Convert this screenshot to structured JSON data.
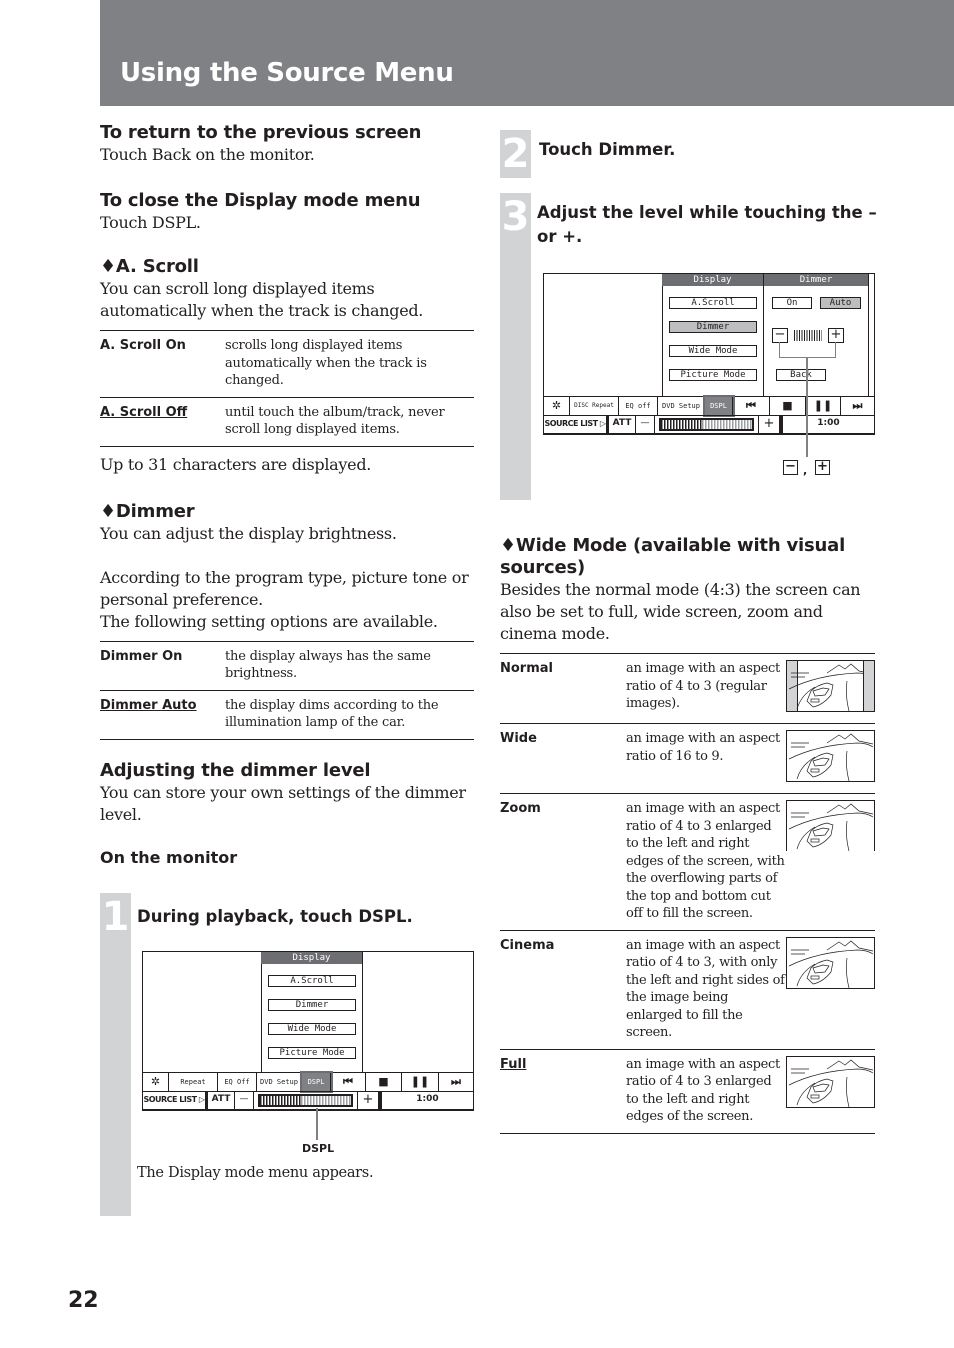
{
  "header": {
    "title": "Using the Source Menu"
  },
  "page_number": "22",
  "left": {
    "return_heading": "To return to the previous screen",
    "return_text": "Touch Back on the monitor.",
    "close_heading": "To close the Display mode menu",
    "close_text": "Touch DSPL.",
    "ascroll": {
      "heading": "♦A. Scroll",
      "intro": "You can scroll long displayed items automatically when the track is changed.",
      "options": [
        {
          "key": "A. Scroll On",
          "value": "scrolls long displayed items automatically when the track is changed.",
          "default": false
        },
        {
          "key": "A. Scroll Off",
          "value": "until touch the album/track, never scroll long displayed items.",
          "default": true
        }
      ],
      "note": "Up to 31 characters are displayed."
    },
    "dimmer": {
      "heading": "♦Dimmer",
      "intro1": "You can adjust the display brightness.",
      "intro2": "According to the program type, picture tone or personal preference.",
      "intro3": "The following setting options are available.",
      "options": [
        {
          "key": "Dimmer On",
          "value": "the display always has the same brightness.",
          "default": false
        },
        {
          "key": "Dimmer Auto",
          "value": "the display dims according to the illumination lamp of the car.",
          "default": true
        }
      ]
    },
    "adjusting": {
      "heading": "Adjusting the dimmer level",
      "text": "You can store your own settings of the dimmer level.",
      "subheading": "On the monitor"
    },
    "step1": {
      "number": "1",
      "title": "During playback, touch DSPL.",
      "callout": "DSPL",
      "caption": "The Display mode menu appears."
    }
  },
  "monitor1": {
    "panel_title": "Display",
    "menu": [
      "A.Scroll",
      "Dimmer",
      "Wide Mode",
      "Picture Mode"
    ],
    "controls": [
      "Repeat",
      "EQ Off",
      "DVD Setup",
      "DSPL"
    ],
    "source_list": "SOURCE LIST ▷",
    "att": "ATT",
    "minus": "—",
    "plus": "+",
    "time": "1:00",
    "volume_level": 0.45
  },
  "right": {
    "step2": {
      "number": "2",
      "title": "Touch Dimmer."
    },
    "step3": {
      "number": "3",
      "title": "Adjust the level while touching the – or +."
    },
    "wide": {
      "heading": "♦Wide Mode (available with visual sources)",
      "intro": "Besides the normal mode (4:3) the screen can also be set to full, wide screen, zoom and cinema mode.",
      "options": [
        {
          "key": "Normal",
          "value": "an image with an aspect ratio of 4 to 3 (regular images).",
          "default": false,
          "thumb": "normal"
        },
        {
          "key": "Wide",
          "value": "an image with an aspect ratio of 16 to 9.",
          "default": false,
          "thumb": "wide"
        },
        {
          "key": "Zoom",
          "value": "an image with an aspect ratio of 4 to 3 enlarged to the left and right edges of the screen, with the overflowing parts of the top and bottom cut off to fill the screen.",
          "default": false,
          "thumb": "zoom"
        },
        {
          "key": "Cinema",
          "value": "an image with an aspect ratio of 4 to 3, with only the left and right sides of the image being enlarged to fill the screen.",
          "default": false,
          "thumb": "cinema"
        },
        {
          "key": "Full",
          "value": "an image with an aspect ratio of 4 to 3 enlarged to the left and right edges of the screen.",
          "default": true,
          "thumb": "full"
        }
      ]
    }
  },
  "monitor2": {
    "panel_title": "Display",
    "menu": [
      "A.Scroll",
      "Dimmer",
      "Wide Mode",
      "Picture Mode"
    ],
    "selected": "Dimmer",
    "sub_title": "Dimmer",
    "sub_on": "On",
    "sub_auto": "Auto",
    "sub_back": "Back",
    "controls": [
      "DISC Repeat",
      "EQ off",
      "DVD Setup",
      "DSPL"
    ],
    "source_list": "SOURCE LIST ▷",
    "att": "ATT",
    "minus": "—",
    "plus": "+",
    "time": "1:00",
    "volume_level": 0.45,
    "callout": ","
  }
}
